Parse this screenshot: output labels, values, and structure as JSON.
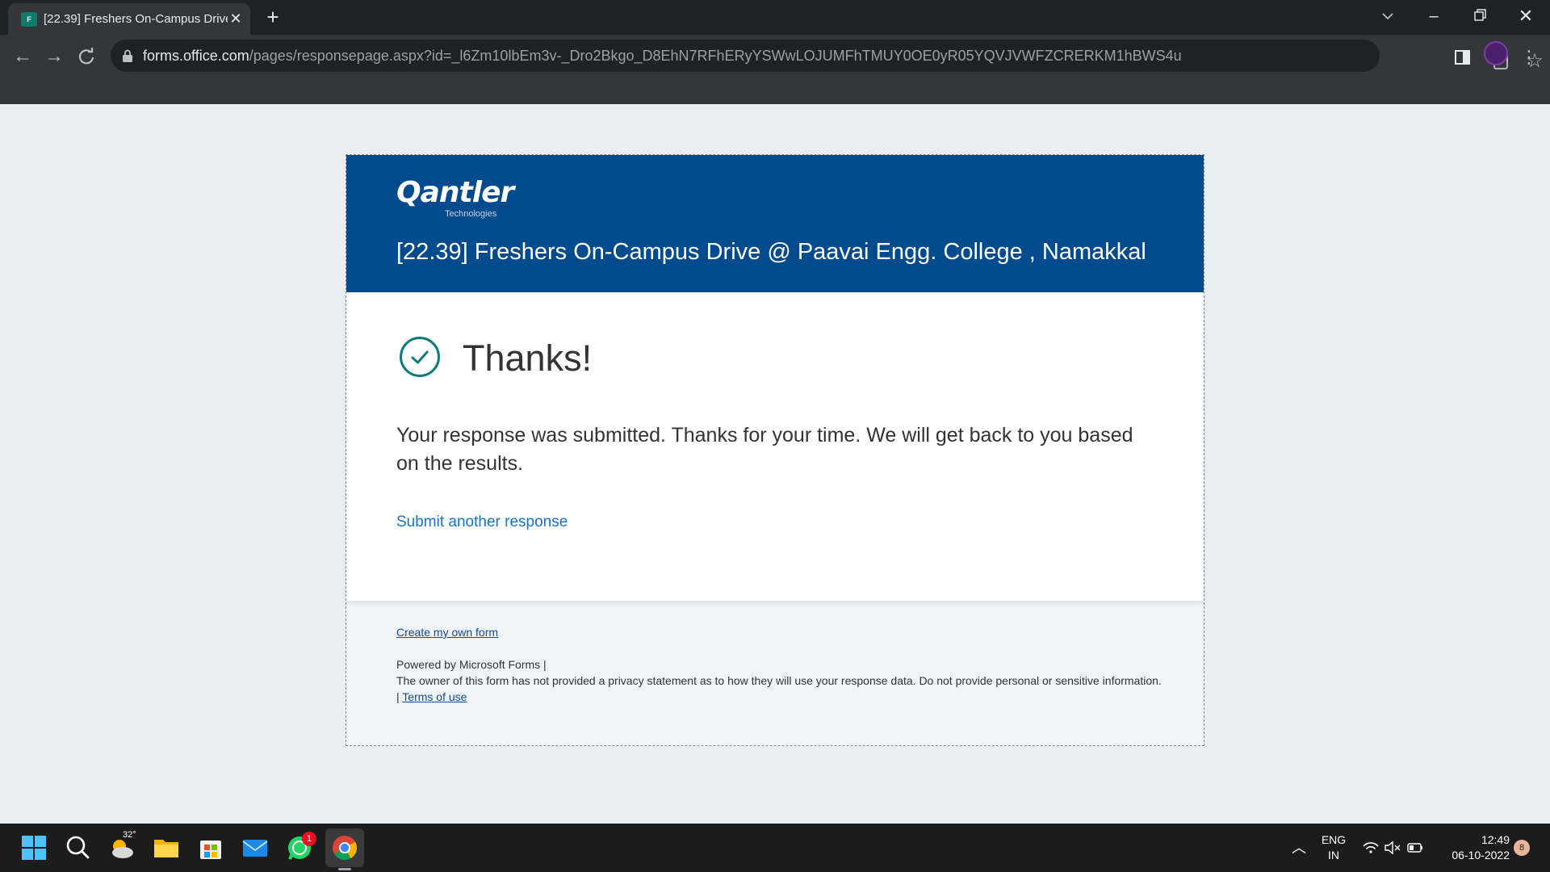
{
  "browser": {
    "tab_title": "[22.39] Freshers On-Campus Drive @ Paavai Engg. College , Namakkal",
    "url_host": "forms.office.com",
    "url_path": "/pages/responsepage.aspx?id=_l6Zm10lbEm3v-_Dro2Bkgo_D8EhN7RFhERyYSWwLOJUMFhTMUY0OE0yR05YQVJVWFZCRERKM1hBWS4u"
  },
  "form": {
    "brand_name": "Qantler",
    "brand_sub": "Technologies",
    "title": "[22.39] Freshers On-Campus Drive @ Paavai Engg. College , Namakkal",
    "thanks_heading": "Thanks!",
    "message": "Your response was submitted. Thanks for your time. We will get back to you based on the results.",
    "submit_another": "Submit another response"
  },
  "footer": {
    "create_link": "Create my own form",
    "powered": "Powered by Microsoft Forms |",
    "privacy": "The owner of this form has not provided a privacy statement as to how they will use your response data. Do not provide personal or sensitive information.",
    "terms_prefix": "|",
    "terms_link": "Terms of use"
  },
  "taskbar": {
    "weather_temp": "32°",
    "whatsapp_badge": "1",
    "lang_line1": "ENG",
    "lang_line2": "IN",
    "time": "12:49",
    "date": "06-10-2022",
    "notification_count": "8"
  },
  "colors": {
    "header_blue": "#004b8d",
    "link_blue": "#1a73c5",
    "check_teal": "#0f7b7b"
  }
}
